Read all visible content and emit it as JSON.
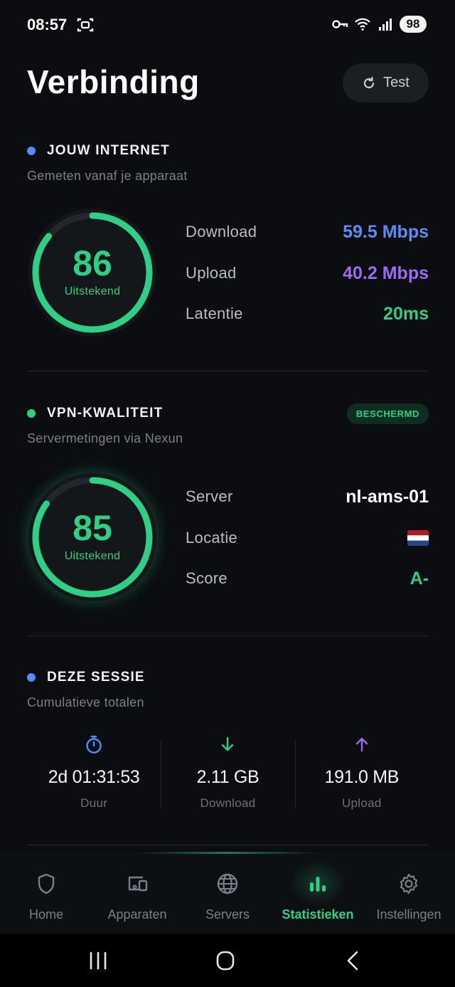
{
  "status_bar": {
    "time": "08:57",
    "battery": "98",
    "icons": [
      "screen-record-icon",
      "vpn-key-icon",
      "wifi-icon",
      "signal-icon"
    ]
  },
  "header": {
    "title": "Verbinding",
    "test_button": "Test"
  },
  "internet": {
    "title": "JOUW INTERNET",
    "subtitle": "Gemeten vanaf je apparaat",
    "score": "86",
    "score_label": "Uitstekend",
    "score_fraction": 0.86,
    "rows": [
      {
        "label": "Download",
        "value": "59.5 Mbps",
        "color": "#5b8df0"
      },
      {
        "label": "Upload",
        "value": "40.2 Mbps",
        "color": "#9b6bf0"
      },
      {
        "label": "Latentie",
        "value": "20ms",
        "color": "#2fcf86"
      }
    ]
  },
  "vpn": {
    "title": "VPN-KWALITEIT",
    "badge": "BESCHERMD",
    "subtitle": "Servermetingen via Nexun",
    "score": "85",
    "score_label": "Uitstekend",
    "score_fraction": 0.85,
    "rows": [
      {
        "label": "Server",
        "value": "nl-ams-01",
        "color": "#ffffff"
      },
      {
        "label": "Locatie",
        "value": "",
        "icon": "netherlands-flag-icon"
      },
      {
        "label": "Score",
        "value": "A-",
        "color": "#2fcf86"
      }
    ]
  },
  "session": {
    "title": "DEZE SESSIE",
    "subtitle": "Cumulatieve totalen",
    "totals": [
      {
        "value": "2d 01:31:53",
        "label": "Duur",
        "icon": "stopwatch-icon",
        "color": "#4f8ef7"
      },
      {
        "value": "2.11 GB",
        "label": "Download",
        "icon": "arrow-down-icon",
        "color": "#2fcf86"
      },
      {
        "value": "191.0 MB",
        "label": "Upload",
        "icon": "arrow-up-icon",
        "color": "#9b6bf0"
      }
    ]
  },
  "nav": {
    "items": [
      {
        "label": "Home",
        "icon": "shield-icon"
      },
      {
        "label": "Apparaten",
        "icon": "devices-icon"
      },
      {
        "label": "Servers",
        "icon": "globe-icon"
      },
      {
        "label": "Statistieken",
        "icon": "bar-chart-icon",
        "active": true
      },
      {
        "label": "Instellingen",
        "icon": "gear-icon"
      }
    ]
  },
  "colors": {
    "accent_green": "#2fcf86",
    "accent_blue": "#4f8ef7",
    "accent_purple": "#9b6bf0",
    "background": "#0b0d10"
  }
}
